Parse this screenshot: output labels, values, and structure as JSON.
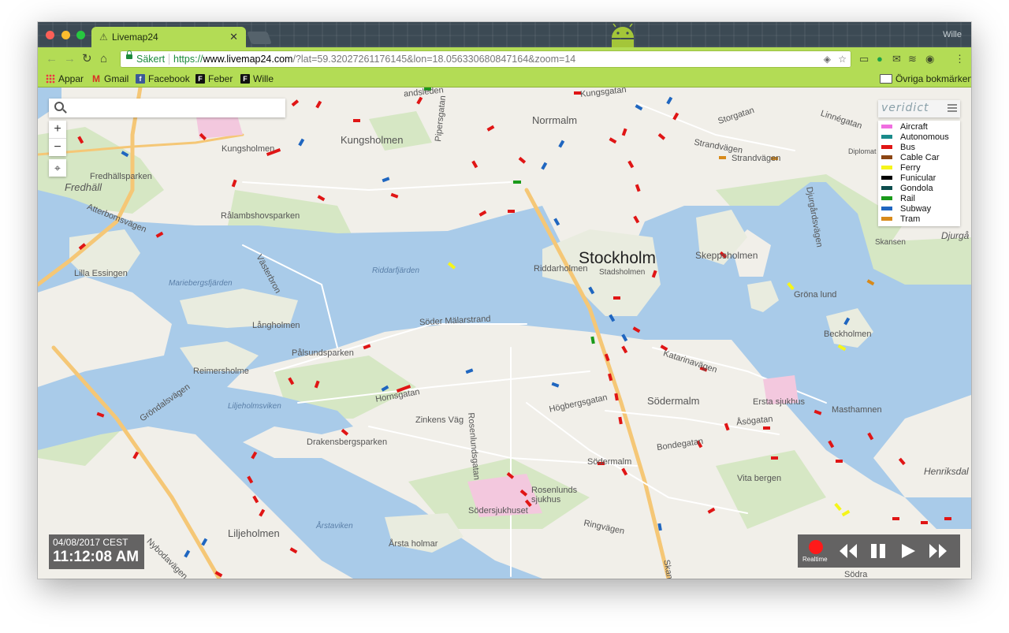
{
  "tab": {
    "title": "Livemap24",
    "profile": "Wille"
  },
  "omnibox": {
    "secure_label": "Säkert",
    "scheme": "https://",
    "host": "www.livemap24.com",
    "path": "/?lat=59.32027261176145&lon=18.056330680847164&zoom=14"
  },
  "bookmarks": {
    "items": [
      {
        "label": "Appar",
        "icon": "apps-icon"
      },
      {
        "label": "Gmail",
        "icon": "gmail-icon"
      },
      {
        "label": "Facebook",
        "icon": "facebook-icon"
      },
      {
        "label": "Feber",
        "icon": "feber-icon"
      },
      {
        "label": "Wille",
        "icon": "feber-icon"
      }
    ],
    "other_label": "Övriga bokmärken"
  },
  "map": {
    "brand": "veridict",
    "search_placeholder": "",
    "zoom_in": "+",
    "zoom_out": "−",
    "labels": {
      "city": "Stockholm",
      "kungsholmen_1": "Kungsholmen",
      "kungsholmen_2": "Kungsholmen",
      "norrmalm": "Norrmalm",
      "sodermalm": "Södermalm",
      "sodermalm_small": "Södermalm",
      "fredhall": "Fredhäll",
      "fredhallsparken": "Fredhällsparken",
      "atterbomsvagen": "Atterbomsvägen",
      "ralambshovsparken": "Rålambshovsparken",
      "riddarfjarden": "Riddarfjärden",
      "lilla_essingen": "Lilla Essingen",
      "mariebergsfjarden": "Mariebergsfjärden",
      "langholmen": "Långholmen",
      "reimersholme": "Reimersholme",
      "palsundsparken": "Pålsundsparken",
      "soder_malarstrand": "Söder Mälarstrand",
      "hornsgatan": "Hornsgatan",
      "zinkens_vag": "Zinkens Väg",
      "rosenlundsgatan": "Rosenlundsgatan",
      "hogbergsgatan": "Högbergsgatan",
      "drakensbergsparken": "Drakensbergsparken",
      "grondalsvagen": "Gröndalsvägen",
      "liljeholmsviken": "Liljeholmsviken",
      "liljeholmen": "Liljeholmen",
      "arstaviken": "Årstaviken",
      "arsta_holmar": "Årsta holmar",
      "sodersjukhuset": "Södersjukhuset",
      "rosenlunds_sjukhus": "Rosenlunds sjukhus",
      "ringvagen": "Ringvägen",
      "bondegatan": "Bondegatan",
      "asogatan": "Åsögatan",
      "katarinavagen": "Katarinavägen",
      "ersta_sjukhus": "Ersta sjukhus",
      "masthamnen": "Masthamnen",
      "vita_bergen": "Vita bergen",
      "henriksdal": "Henriksdal",
      "skeppsholmen": "Skeppsholmen",
      "grona_lund": "Gröna lund",
      "beckholmen": "Beckholmen",
      "skansen": "Skansen",
      "djurgarden": "Djurgå",
      "djurgardsvagen": "Djurgårdsvägen",
      "strandvagen_1": "Strandvägen",
      "strandvagen_2": "Strandvägen",
      "storgatan": "Storgatan",
      "linnegatan": "Linnégatan",
      "kungsgatan": "Kungsgatan",
      "fleminggatan": "andsleden",
      "riddarholmen": "Riddarholmen",
      "stadsholmen": "Stadsholmen",
      "pipersgatan": "Pipersgatan",
      "vasterbron": "Västerbron",
      "nybodagatan": "Nybodavägen",
      "diplomat": "Diplomat",
      "ringvagen_vertical": "Skanstull",
      "sodra": "Södra"
    }
  },
  "legend": [
    {
      "label": "Aircraft",
      "color": "#f06ee0"
    },
    {
      "label": "Autonomous",
      "color": "#1a8b8b"
    },
    {
      "label": "Bus",
      "color": "#e01515"
    },
    {
      "label": "Cable Car",
      "color": "#8b4513"
    },
    {
      "label": "Ferry",
      "color": "#f5f51a"
    },
    {
      "label": "Funicular",
      "color": "#000000"
    },
    {
      "label": "Gondola",
      "color": "#0d4d4d"
    },
    {
      "label": "Rail",
      "color": "#1a9a1a"
    },
    {
      "label": "Subway",
      "color": "#1f66c0"
    },
    {
      "label": "Tram",
      "color": "#d88a1a"
    }
  ],
  "timebox": {
    "date": "04/08/2017 CEST",
    "time": "11:12:08 AM"
  },
  "player": {
    "realtime_label": "Realtime"
  }
}
